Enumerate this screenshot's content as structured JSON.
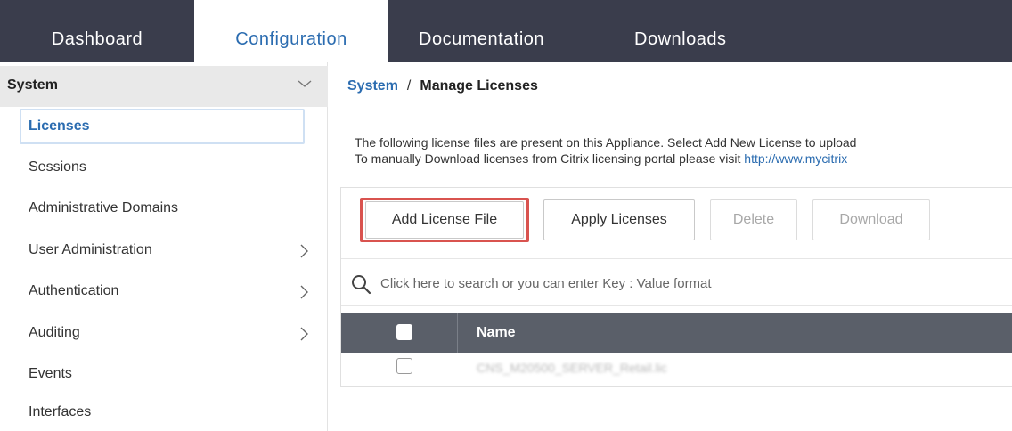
{
  "nav": {
    "tabs": [
      {
        "label": "Dashboard"
      },
      {
        "label": "Configuration"
      },
      {
        "label": "Documentation"
      },
      {
        "label": "Downloads"
      }
    ],
    "active": "Configuration"
  },
  "sidebar": {
    "header": "System",
    "items": [
      {
        "label": "Licenses",
        "active": true
      },
      {
        "label": "Sessions"
      },
      {
        "label": "Administrative Domains"
      },
      {
        "label": "User Administration",
        "has_submenu": true
      },
      {
        "label": "Authentication",
        "has_submenu": true
      },
      {
        "label": "Auditing",
        "has_submenu": true
      },
      {
        "label": "Events"
      },
      {
        "label": "Interfaces"
      }
    ]
  },
  "breadcrumb": {
    "parent": "System",
    "separator": "/",
    "current": "Manage Licenses"
  },
  "description": {
    "line1": "The following license files are present on this Appliance. Select Add New License to upload",
    "line2_prefix": "To manually Download licenses from Citrix licensing portal please visit ",
    "line2_link": "http://www.mycitrix"
  },
  "toolbar": {
    "add_label": "Add License File",
    "apply_label": "Apply Licenses",
    "delete_label": "Delete",
    "download_label": "Download"
  },
  "search": {
    "placeholder": "Click here to search or you can enter Key : Value format"
  },
  "table": {
    "columns": [
      "Name"
    ],
    "rows": [
      {
        "name": "CNS_M20500_SERVER_Retail.lic"
      }
    ]
  },
  "colors": {
    "nav_bg": "#3a3d4c",
    "accent": "#2b6cb0",
    "highlight": "#d9534f",
    "table_header": "#5a5f69"
  }
}
